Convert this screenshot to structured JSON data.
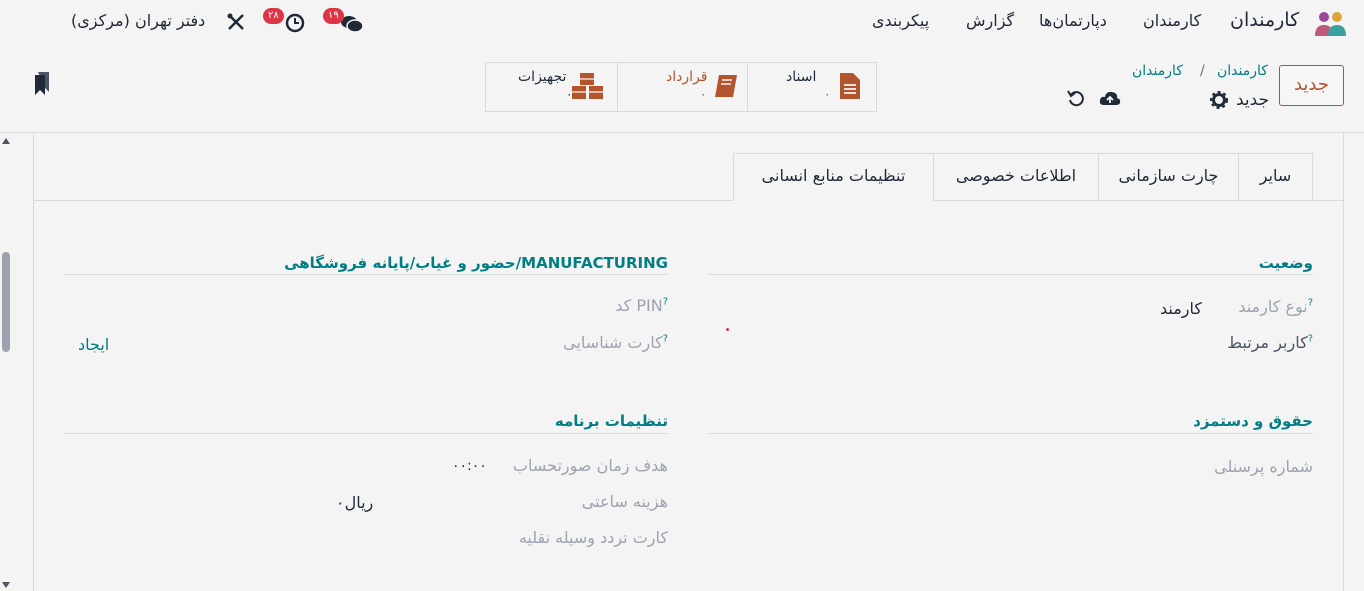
{
  "navbar": {
    "app_name": "کارمندان",
    "menu": [
      "کارمندان",
      "دپارتمان‌ها",
      "گزارش",
      "پیکربندی"
    ],
    "messages_count": "۱۹",
    "activities_count": "۲۸",
    "company": "دفتر تهران (مرکزی)"
  },
  "control_panel": {
    "new_button": "جدید",
    "breadcrumb": [
      "کارمندان",
      "کارمندان"
    ],
    "breadcrumb_sep": "/",
    "record_name": "جدید",
    "smart_buttons": [
      {
        "label": "اسناد",
        "value": "۰"
      },
      {
        "label": "قرارداد",
        "value": "۰"
      },
      {
        "label": "تجهیزات",
        "value": "۰"
      }
    ]
  },
  "tabs": [
    "سایر",
    "چارت سازمانی",
    "اطلاعات خصوصی",
    "تنظیمات منابع انسانی"
  ],
  "active_tab": "تنظیمات منابع انسانی",
  "sections": {
    "status": {
      "title": "وضعیت",
      "employee_type_label": "نوع کارمند",
      "employee_type_value": "کارمند",
      "related_user_label": "کاربر مرتبط"
    },
    "attendance": {
      "title": "حضور و غیاب/پایانه فروشگاهی/MANUFACTURING",
      "pin_label": "کد PIN",
      "badge_label": "کارت شناسایی",
      "create_link": "ایجاد"
    },
    "payroll": {
      "title": "حقوق و دستمزد",
      "reg_number_label": "شماره پرسنلی"
    },
    "app_settings": {
      "title": "تنظیمات برنامه",
      "invoice_target_label": "هدف زمان صورتحساب",
      "invoice_target_value": "۰۰:۰۰",
      "hourly_cost_label": "هزینه ساعتی",
      "hourly_cost_value": "۰ریال",
      "vehicle_card_label": "کارت تردد وسیله نقلیه"
    }
  },
  "help_mark": "?",
  "colors": {
    "accent": "#017e84",
    "primary": "#b4542c",
    "badge": "#dc3545"
  }
}
